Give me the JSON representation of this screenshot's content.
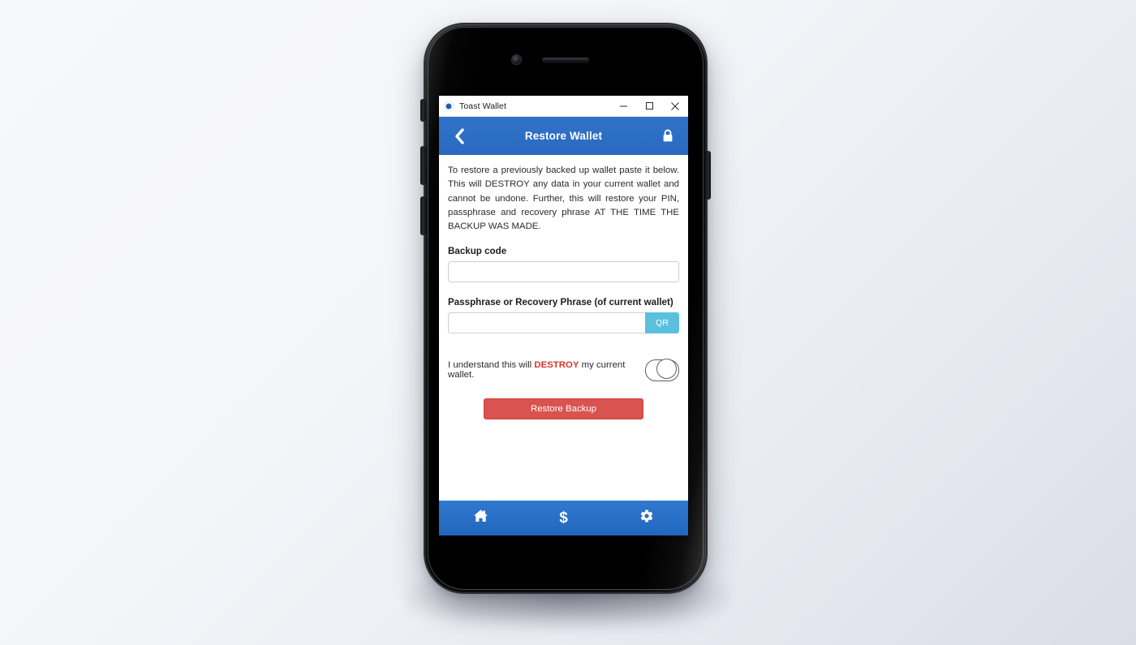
{
  "window": {
    "app_title": "Toast Wallet",
    "logo_icon": "toast-wallet-logo",
    "minimize_icon": "minimize-icon",
    "maximize_icon": "maximize-icon",
    "close_icon": "close-icon"
  },
  "header": {
    "back_icon": "chevron-left-icon",
    "title": "Restore Wallet",
    "lock_icon": "lock-icon",
    "color": "#2c6fc4"
  },
  "content": {
    "intro": "To restore a previously backed up wallet paste it below. This will DESTROY any data in your current wallet and cannot be undone. Further, this will restore your PIN, passphrase and recovery phrase AT THE TIME THE BACKUP WAS MADE.",
    "backup_code": {
      "label": "Backup code",
      "value": "",
      "placeholder": ""
    },
    "passphrase": {
      "label": "Passphrase or Recovery Phrase (of current wallet)",
      "value": "",
      "placeholder": "",
      "qr_label": "QR",
      "qr_color": "#5bc0de"
    },
    "consent": {
      "text_before": "I understand this will ",
      "text_emphasis": "DESTROY",
      "text_after": " my current wallet.",
      "emphasis_color": "#d9342b",
      "toggle_state": "off"
    },
    "restore_button": {
      "label": "Restore Backup",
      "color": "#d9534f"
    }
  },
  "bottom_nav": {
    "items": [
      {
        "name": "home",
        "icon": "home-icon",
        "label": ""
      },
      {
        "name": "dollar",
        "icon": "dollar-icon",
        "label": "$"
      },
      {
        "name": "settings",
        "icon": "gear-icon",
        "label": ""
      }
    ],
    "color": "#2166bd"
  }
}
